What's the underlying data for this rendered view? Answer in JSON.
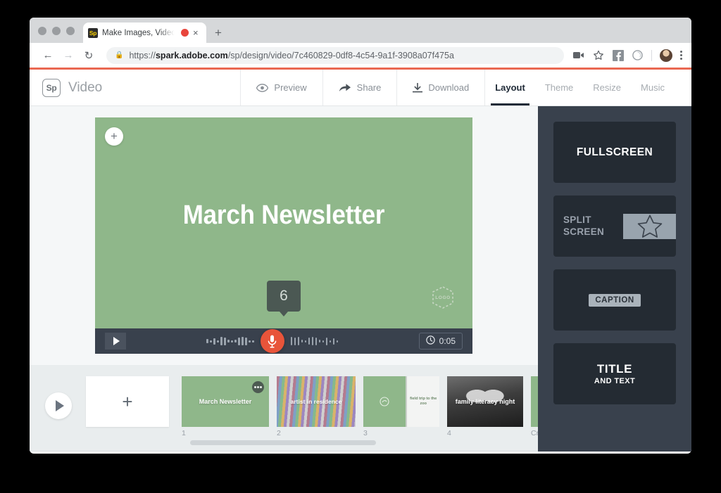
{
  "browser": {
    "tab": {
      "favicon_text": "Sp",
      "title": "Make Images, Videos and W",
      "recording_icon": "record-dot",
      "close_icon": "×"
    },
    "new_tab_icon": "+",
    "nav": {
      "back_icon": "←",
      "forward_icon": "→",
      "reload_icon": "↻"
    },
    "omnibox": {
      "lock_icon": "🔒",
      "scheme": "https://",
      "host": "spark.adobe.com",
      "path": "/sp/design/video/7c460829-0df8-4c54-9a1f-3908a07f475a",
      "full_url": "https://spark.adobe.com/sp/design/video/7c460829-0df8-4c54-9a1f-3908a07f475a"
    },
    "extensions": [
      {
        "name": "video-camera-icon"
      },
      {
        "name": "bookmark-star-icon"
      },
      {
        "name": "facebook-icon"
      },
      {
        "name": "circle-extension-icon"
      }
    ],
    "profile": "user-avatar",
    "menu_icon": "kebab-menu"
  },
  "app_header": {
    "logo_text": "Sp",
    "title": "Video",
    "actions": [
      {
        "label": "Preview",
        "icon": "eye-icon"
      },
      {
        "label": "Share",
        "icon": "share-arrow-icon"
      },
      {
        "label": "Download",
        "icon": "download-icon"
      }
    ],
    "tabs": [
      {
        "label": "Layout",
        "active": true
      },
      {
        "label": "Theme",
        "active": false
      },
      {
        "label": "Resize",
        "active": false
      },
      {
        "label": "Music",
        "active": false
      }
    ]
  },
  "canvas": {
    "background_color": "#8fb78a",
    "add_icon": "+",
    "title": "March Newsletter",
    "countdown": "6",
    "logo_placeholder": "LOGO"
  },
  "player": {
    "play_icon": "play-triangle",
    "mic_icon": "microphone-icon",
    "mic_color": "#e8543a",
    "clock_icon": "clock-icon",
    "duration": "0:05",
    "waveform": [
      6,
      3,
      9,
      3,
      12,
      11,
      4,
      3,
      4,
      11,
      12,
      11,
      3,
      3,
      12,
      11,
      12,
      4,
      3,
      10,
      12,
      11,
      4,
      3,
      11,
      3,
      9,
      3
    ]
  },
  "layout_panel": {
    "background_color": "#39414d",
    "options": [
      {
        "name": "fullscreen",
        "label": "FULLSCREEN"
      },
      {
        "name": "split-screen",
        "label_line1": "SPLIT",
        "label_line2": "SCREEN",
        "icon": "star-outline-icon"
      },
      {
        "name": "caption",
        "label": "CAPTION"
      },
      {
        "name": "title-and-text",
        "label_line1": "TITLE",
        "label_line2": "AND TEXT"
      }
    ]
  },
  "filmstrip": {
    "play_icon": "play-triangle",
    "add_slide_icon": "+",
    "slides": [
      {
        "number": "1",
        "label": "March Newsletter",
        "menu_icon": "more-dots-icon"
      },
      {
        "number": "2",
        "label": "artist in residence"
      },
      {
        "number": "3",
        "label": "field trip to the zoo"
      },
      {
        "number": "4",
        "label": "family literacy night"
      },
      {
        "number": "Credits",
        "label": ""
      }
    ]
  }
}
